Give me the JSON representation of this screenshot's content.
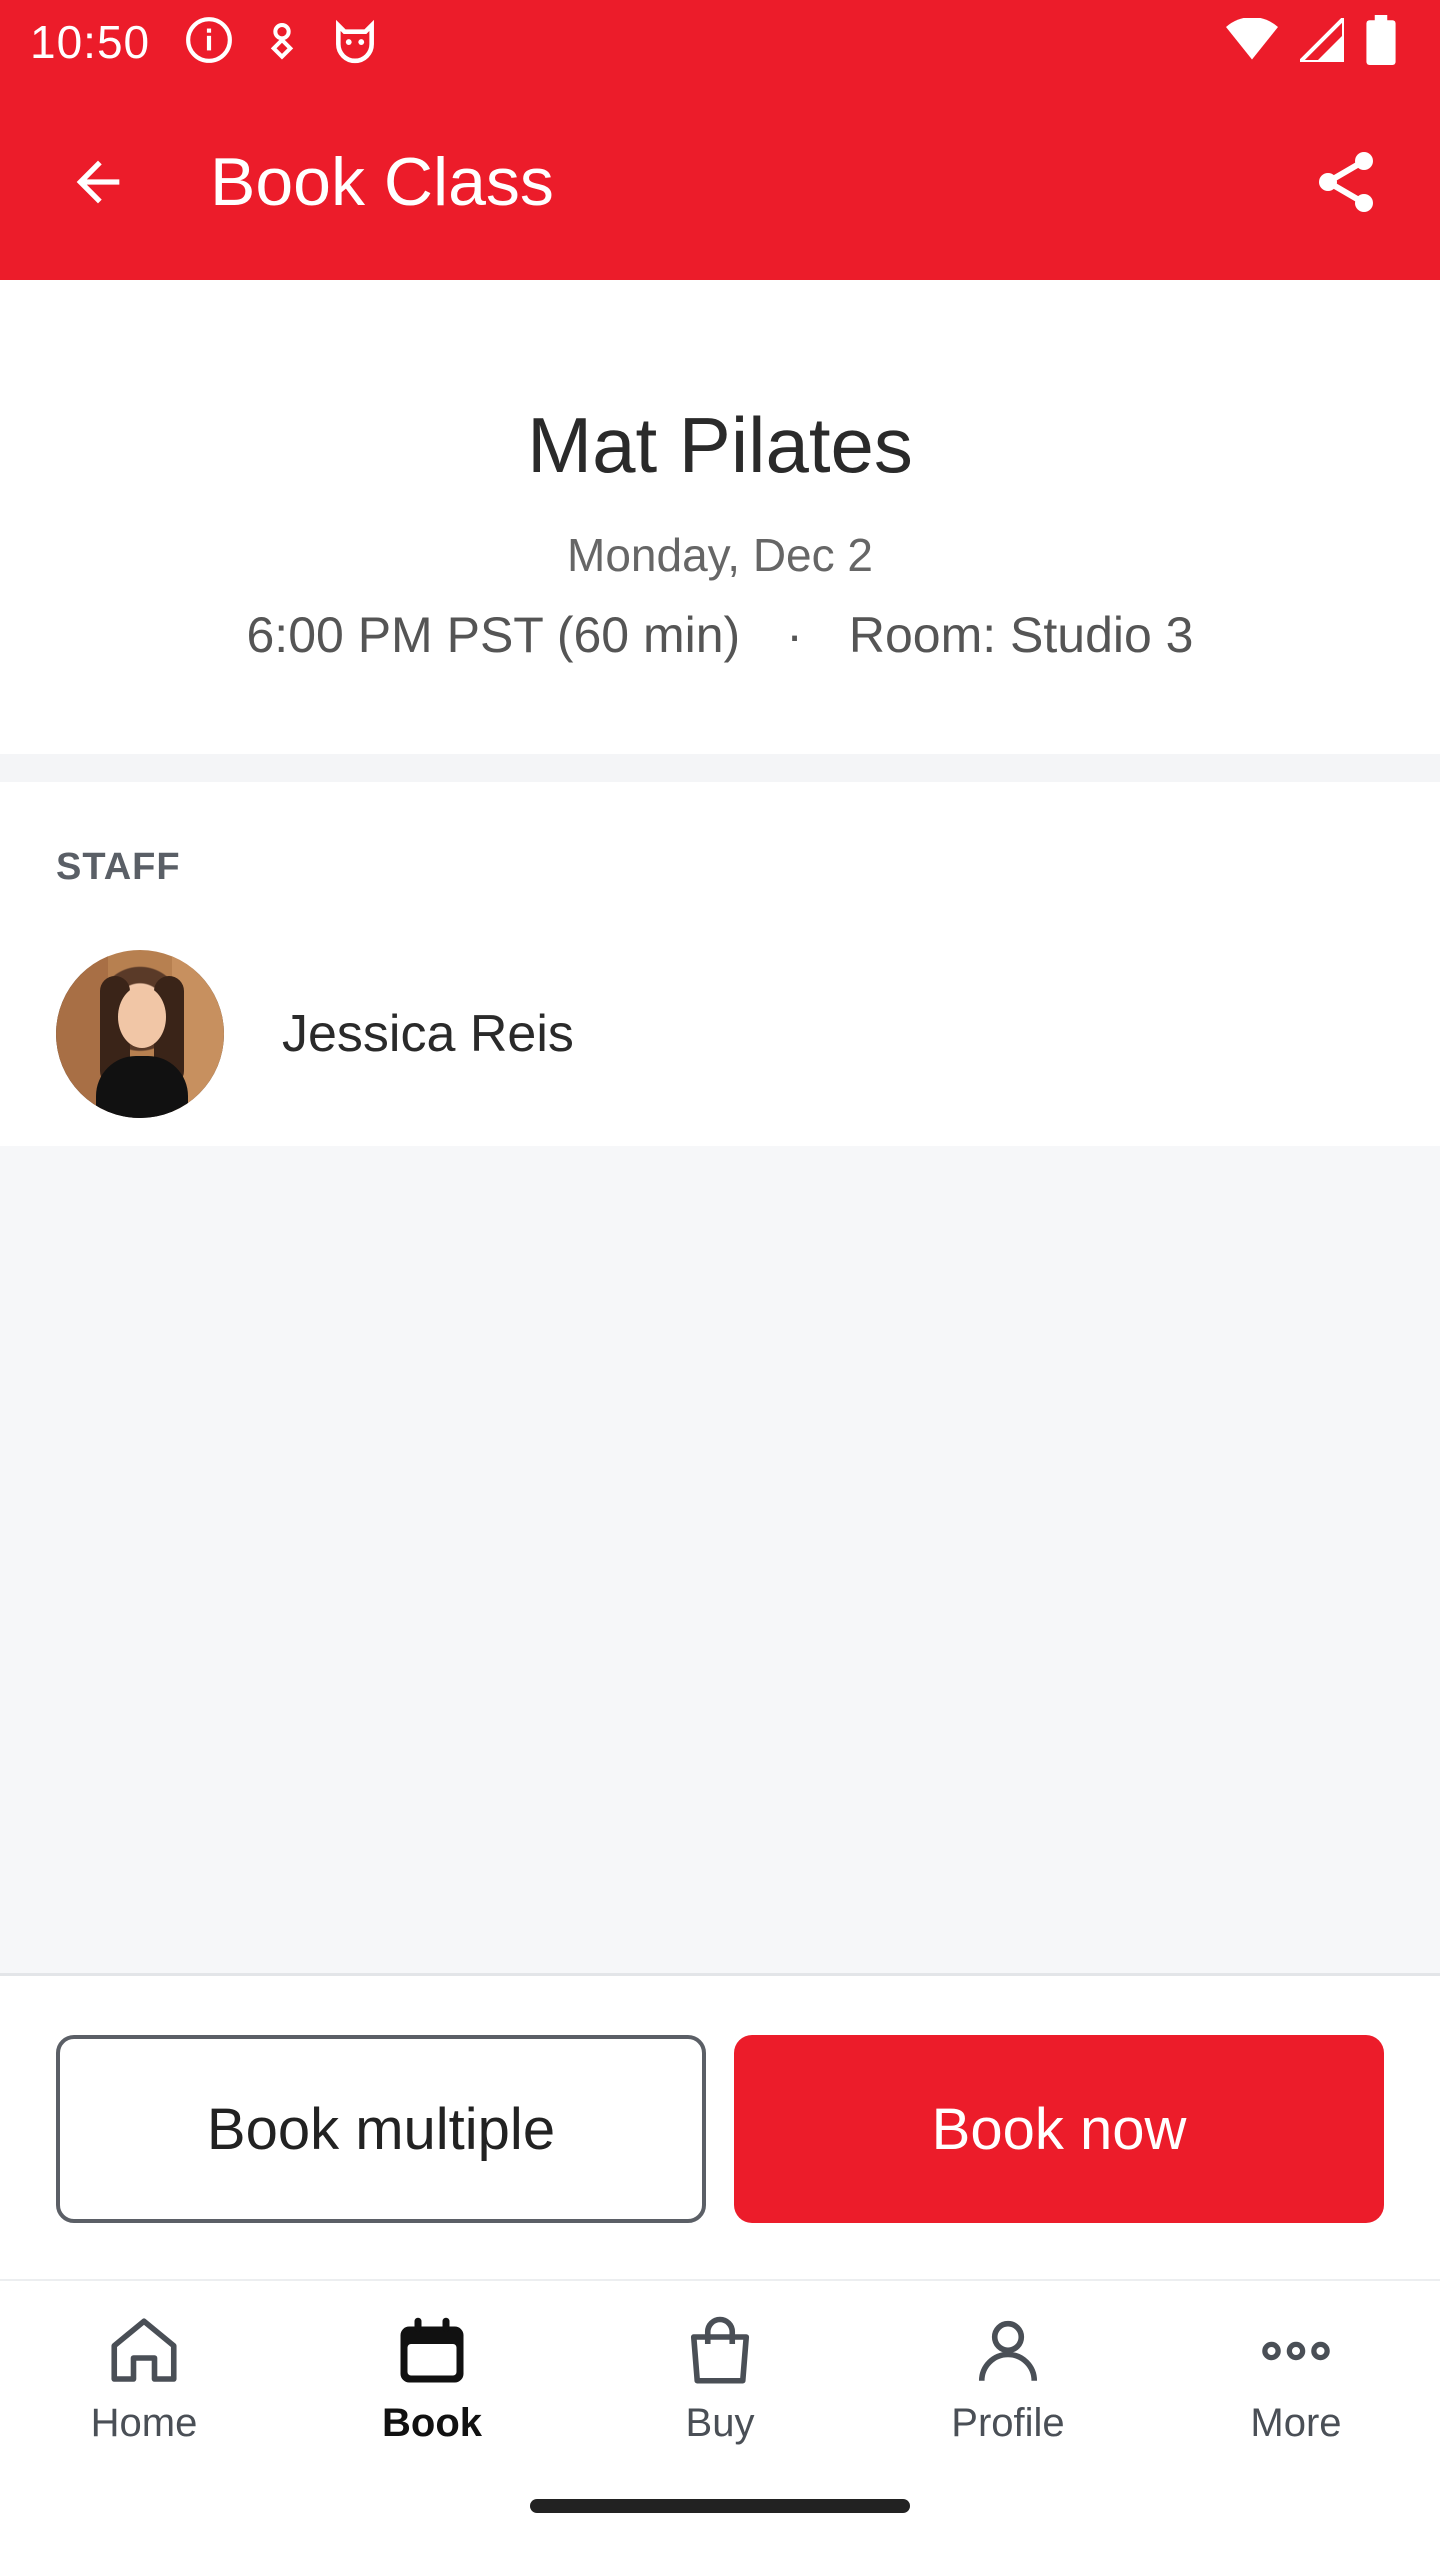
{
  "status_bar": {
    "time": "10:50",
    "icons_left": [
      "info-icon",
      "location-icon",
      "cat-app-icon"
    ],
    "icons_right": [
      "wifi-icon",
      "cellular-signal-icon",
      "battery-icon"
    ]
  },
  "app_bar": {
    "title": "Book Class",
    "back_icon": "arrow-back-icon",
    "share_icon": "share-icon",
    "background": "#ec1c2a"
  },
  "class": {
    "name": "Mat Pilates",
    "date": "Monday, Dec 2",
    "time": "6:00 PM PST (60 min)",
    "separator": "·",
    "room": "Room: Studio 3"
  },
  "staff": {
    "heading": "STAFF",
    "members": [
      {
        "name": "Jessica Reis"
      }
    ]
  },
  "actions": {
    "book_multiple": "Book multiple",
    "book_now": "Book now"
  },
  "bottom_nav": {
    "items": [
      {
        "label": "Home",
        "icon": "home-icon",
        "active": false
      },
      {
        "label": "Book",
        "icon": "calendar-icon",
        "active": true
      },
      {
        "label": "Buy",
        "icon": "shopping-bag-icon",
        "active": false
      },
      {
        "label": "Profile",
        "icon": "person-icon",
        "active": false
      },
      {
        "label": "More",
        "icon": "more-icon",
        "active": false
      }
    ]
  },
  "colors": {
    "brand_red": "#ec1c2a",
    "surface_gray": "#f6f7f9"
  }
}
